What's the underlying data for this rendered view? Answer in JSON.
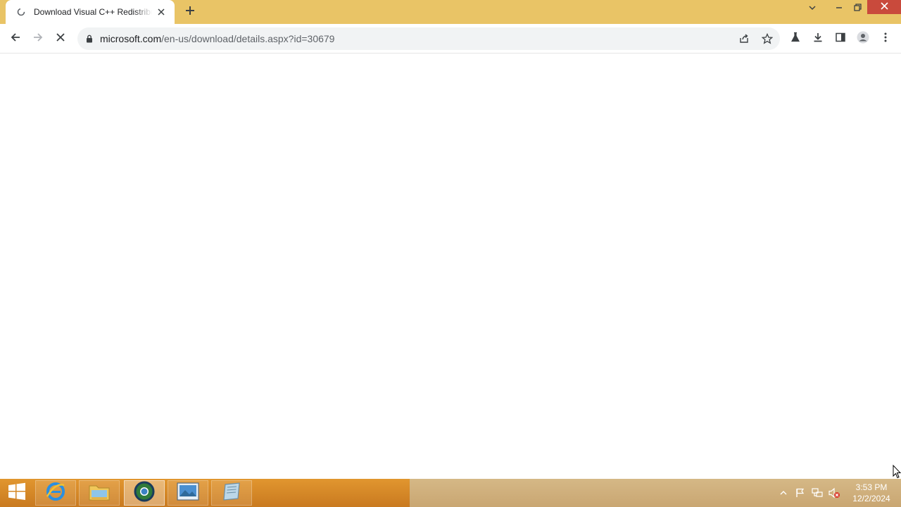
{
  "browser": {
    "tab": {
      "title": "Download Visual C++ Redistributable",
      "favicon": "loading-icon"
    },
    "new_tab_icon": "plus-icon",
    "window_controls": [
      "tab-search-icon",
      "minimize-icon",
      "restore-icon",
      "close-icon"
    ],
    "toolbar": {
      "back_icon": "arrow-left-icon",
      "forward_icon": "arrow-right-icon",
      "stop_icon": "x-icon",
      "url_domain": "microsoft.com",
      "url_path": "/en-us/download/details.aspx?id=30679",
      "omnibox_icons": [
        "share-icon",
        "star-icon"
      ],
      "extension_icons": [
        "flask-icon",
        "download-icon",
        "side-panel-icon",
        "profile-icon",
        "menu-icon"
      ]
    }
  },
  "taskbar": {
    "apps": [
      "internet-explorer-icon",
      "file-explorer-icon",
      "chrome-icon",
      "image-viewer-icon",
      "app-icon"
    ],
    "tray_icons": [
      "show-hidden-icon",
      "flag-icon",
      "network-icon",
      "volume-muted-icon"
    ],
    "clock": {
      "time": "3:53 PM",
      "date": "12/2/2024"
    }
  },
  "colors": {
    "title_bar": "#e9c466",
    "close_button": "#c94a3c",
    "taskbar": "#d88a2a"
  }
}
